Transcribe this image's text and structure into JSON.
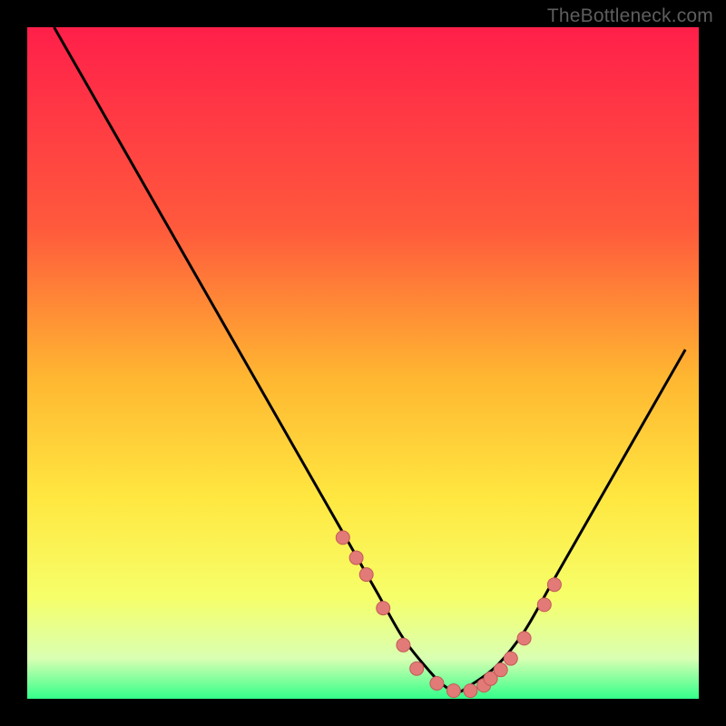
{
  "watermark": "TheBottleneck.com",
  "colors": {
    "grad_top": "#ff1f4a",
    "grad_mid1": "#ff5a3c",
    "grad_mid2": "#ffb631",
    "grad_mid3": "#ffe740",
    "grad_low1": "#f6ff6a",
    "grad_low2": "#d9ffb2",
    "grad_bottom": "#33ff8a",
    "curve": "#000000",
    "dot_fill": "#e27a78",
    "dot_stroke": "#c35a58"
  },
  "chart_data": {
    "type": "line",
    "title": "",
    "xlabel": "",
    "ylabel": "",
    "xlim": [
      0,
      100
    ],
    "ylim": [
      0,
      100
    ],
    "series": [
      {
        "name": "bottleneck-curve",
        "x": [
          4,
          8,
          12,
          16,
          20,
          24,
          28,
          32,
          36,
          40,
          44,
          48,
          52,
          56,
          60,
          62,
          64,
          66,
          70,
          74,
          78,
          82,
          86,
          90,
          94,
          98
        ],
        "y": [
          100,
          93,
          86,
          79,
          72,
          65,
          58,
          51,
          44,
          37,
          30,
          23,
          16,
          9,
          4,
          2,
          1,
          2,
          5,
          10,
          17,
          24,
          31,
          38,
          45,
          52
        ]
      }
    ],
    "markers": {
      "name": "bottleneck-dots",
      "x": [
        47,
        49,
        50.5,
        53,
        56,
        58,
        61,
        63.5,
        66,
        68,
        69,
        70.5,
        72,
        74,
        77,
        78.5
      ],
      "y": [
        24,
        21,
        18.5,
        13.5,
        8,
        4.5,
        2.3,
        1.2,
        1.2,
        2,
        3,
        4.3,
        6,
        9,
        14,
        17
      ]
    }
  }
}
